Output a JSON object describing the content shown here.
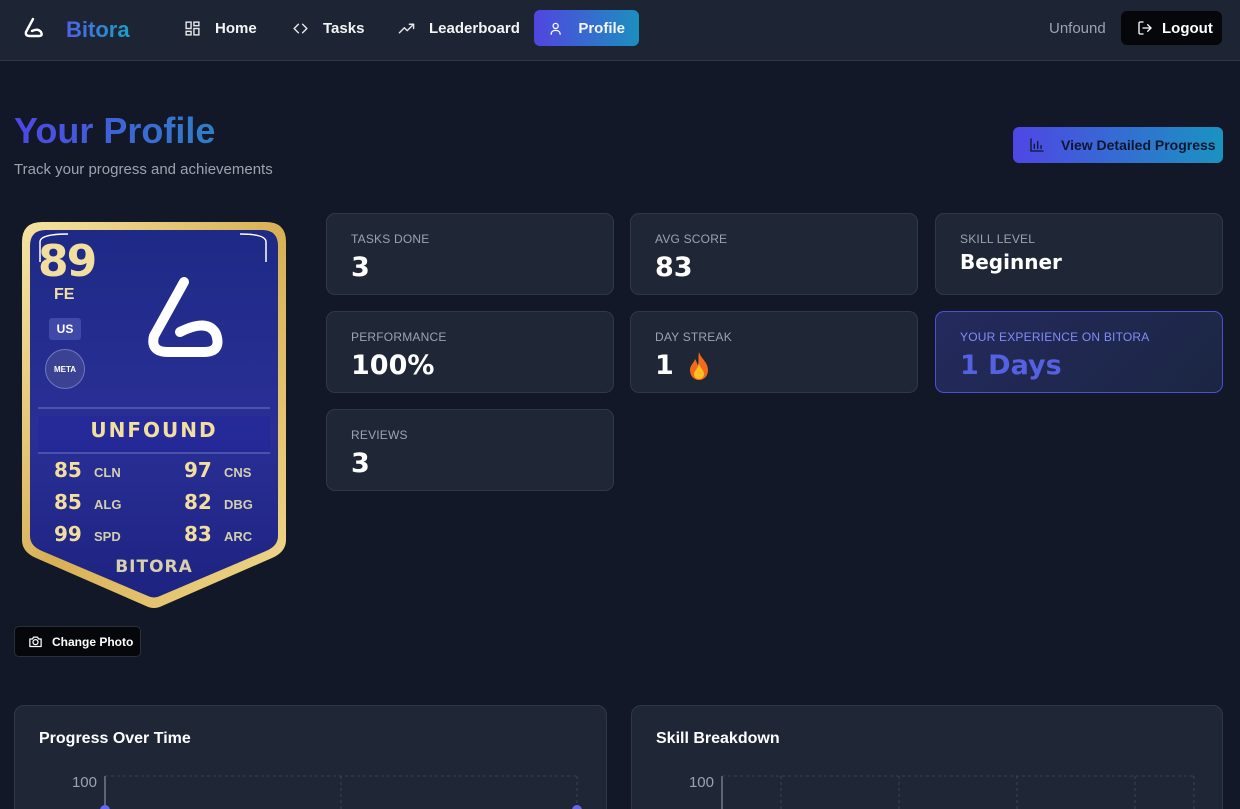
{
  "nav": {
    "brand": "Bitora",
    "items": [
      {
        "label": "Home",
        "icon": "grid-icon"
      },
      {
        "label": "Tasks",
        "icon": "code-icon"
      },
      {
        "label": "Leaderboard",
        "icon": "trend-up-icon"
      },
      {
        "label": "Profile",
        "icon": "user-icon",
        "active": true
      }
    ],
    "username": "Unfound",
    "logout_label": "Logout"
  },
  "header": {
    "title": "Your Profile",
    "subtitle": "Track your progress and achievements",
    "detail_button": "View Detailed Progress"
  },
  "player_card": {
    "rating": "89",
    "position": "FE",
    "country": "US",
    "club": "META",
    "name": "UNFOUND",
    "stats": [
      {
        "value": "85",
        "label": "CLN"
      },
      {
        "value": "97",
        "label": "CNS"
      },
      {
        "value": "85",
        "label": "ALG"
      },
      {
        "value": "82",
        "label": "DBG"
      },
      {
        "value": "99",
        "label": "SPD"
      },
      {
        "value": "83",
        "label": "ARC"
      }
    ],
    "footer": "BITORA",
    "change_photo_label": "Change Photo"
  },
  "stats": {
    "tasks_done": {
      "label": "TASKS DONE",
      "value": "3"
    },
    "avg_score": {
      "label": "AVG SCORE",
      "value": "83"
    },
    "skill_level": {
      "label": "SKILL LEVEL",
      "value": "Beginner"
    },
    "performance": {
      "label": "PERFORMANCE",
      "value": "100%"
    },
    "day_streak": {
      "label": "DAY STREAK",
      "value": "1"
    },
    "experience": {
      "label": "YOUR EXPERIENCE ON BITORA",
      "value": "1 Days"
    },
    "reviews": {
      "label": "REVIEWS",
      "value": "3"
    }
  },
  "panels": {
    "progress": {
      "title": "Progress Over Time",
      "y_max": "100"
    },
    "skills": {
      "title": "Skill Breakdown",
      "y_max": "100"
    }
  },
  "colors": {
    "accent_start": "#4f46e5",
    "accent_end": "#1a93c0",
    "background": "#121827",
    "card_gold": "#e8c766",
    "card_blue": "#2a2f96"
  }
}
